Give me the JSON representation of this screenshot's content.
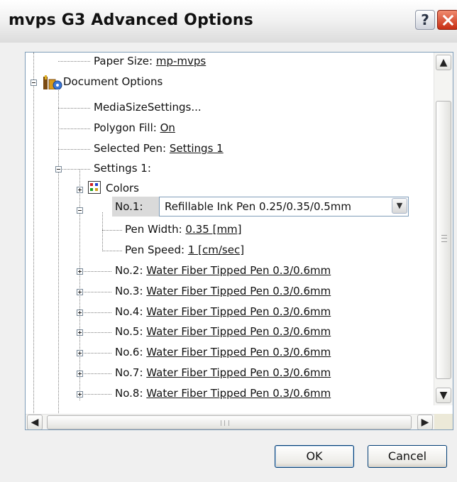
{
  "window": {
    "title": "mvps G3 Advanced Options",
    "help_label": "?"
  },
  "tree": {
    "paper_size_label": "Paper Size: ",
    "paper_size_value": "mp-mvps",
    "document_options": "Document Options",
    "media_size_settings": "MediaSizeSettings...",
    "polygon_fill_label": "Polygon Fill: ",
    "polygon_fill_value": "On",
    "selected_pen_label": "Selected Pen: ",
    "selected_pen_value": "Settings 1",
    "settings1": "Settings 1:",
    "colors": "Colors",
    "no1_label": "No.1:",
    "no1_value": "Refillable Ink Pen 0.25/0.35/0.5mm",
    "pen_width_label": "Pen Width: ",
    "pen_width_value": "0.35 [mm]",
    "pen_speed_label": "Pen Speed: ",
    "pen_speed_value": "1 [cm/sec]",
    "pens": [
      {
        "label": "No.2: ",
        "value": "Water Fiber Tipped Pen 0.3/0.6mm"
      },
      {
        "label": "No.3: ",
        "value": "Water Fiber Tipped Pen 0.3/0.6mm"
      },
      {
        "label": "No.4: ",
        "value": "Water Fiber Tipped Pen 0.3/0.6mm"
      },
      {
        "label": "No.5: ",
        "value": "Water Fiber Tipped Pen 0.3/0.6mm"
      },
      {
        "label": "No.6: ",
        "value": "Water Fiber Tipped Pen 0.3/0.6mm"
      },
      {
        "label": "No.7: ",
        "value": "Water Fiber Tipped Pen 0.3/0.6mm"
      },
      {
        "label": "No.8: ",
        "value": "Water Fiber Tipped Pen 0.3/0.6mm"
      }
    ]
  },
  "buttons": {
    "ok": "OK",
    "cancel": "Cancel"
  },
  "icons": {
    "expanded": "minus-box-icon",
    "collapsed": "plus-box-icon",
    "document": "document-options-icon",
    "colors": "color-palette-icon"
  }
}
